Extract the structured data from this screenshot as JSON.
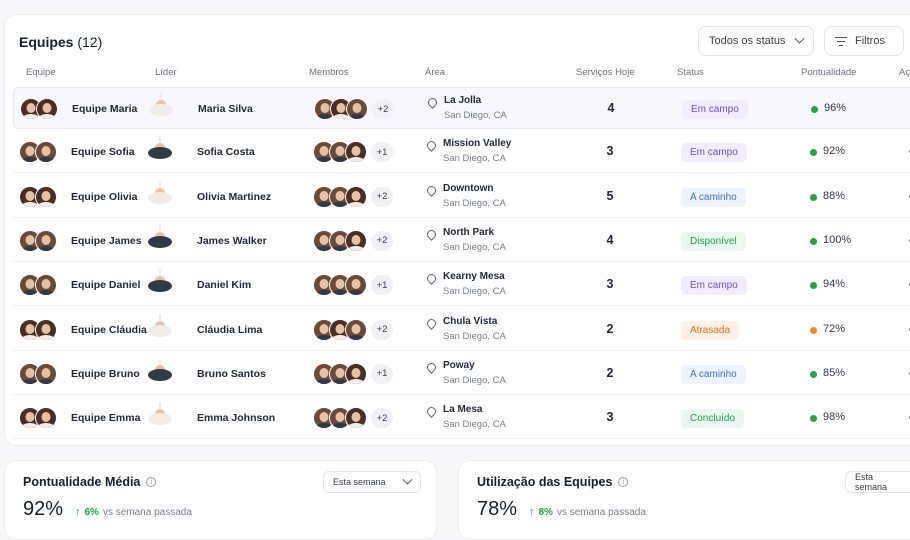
{
  "teams_card": {
    "title": "Equipes",
    "count": "(12)",
    "status_filter": "Todos os status",
    "filters_button": "Filtros",
    "columns": [
      "Equipe",
      "Líder",
      "Membros",
      "Área",
      "Serviços Hoje",
      "Status",
      "Pontualidade",
      "Ações"
    ]
  },
  "colors": {
    "accent": "#6d4ee0",
    "green_dot": "#22a447",
    "orange_dot": "#f08a24"
  },
  "rows": [
    {
      "team": "Equipe Maria",
      "leader": "Maria Silva",
      "leader_gender": "f",
      "team_avatars": [
        "f",
        "f"
      ],
      "members": [
        "m",
        "f",
        "m"
      ],
      "more": "+2",
      "area": "La Jolla",
      "city": "San Diego, CA",
      "services": "4",
      "status": "Em campo",
      "status_kind": "field",
      "punctuality": "96%",
      "dot": "green"
    },
    {
      "team": "Equipe Sofia",
      "leader": "Sofia Costa",
      "leader_gender": "m",
      "team_avatars": [
        "m",
        "m"
      ],
      "members": [
        "m",
        "m",
        "f"
      ],
      "more": "+1",
      "area": "Mission Valley",
      "city": "San Diego, CA",
      "services": "3",
      "status": "Em campo",
      "status_kind": "field",
      "punctuality": "92%",
      "dot": "green"
    },
    {
      "team": "Equipe Olivia",
      "leader": "Olivia Martinez",
      "leader_gender": "f",
      "team_avatars": [
        "f",
        "f"
      ],
      "members": [
        "m",
        "m",
        "f"
      ],
      "more": "+2",
      "area": "Downtown",
      "city": "San Diego, CA",
      "services": "5",
      "status": "A caminho",
      "status_kind": "route",
      "punctuality": "88%",
      "dot": "green"
    },
    {
      "team": "Equipe James",
      "leader": "James Walker",
      "leader_gender": "m",
      "team_avatars": [
        "m",
        "m"
      ],
      "members": [
        "m",
        "m",
        "f"
      ],
      "more": "+2",
      "area": "North Park",
      "city": "San Diego, CA",
      "services": "4",
      "status": "Disponível",
      "status_kind": "available",
      "punctuality": "100%",
      "dot": "green"
    },
    {
      "team": "Equipe Daniel",
      "leader": "Daniel Kim",
      "leader_gender": "m",
      "team_avatars": [
        "m",
        "m"
      ],
      "members": [
        "m",
        "m",
        "m"
      ],
      "more": "+1",
      "area": "Kearny Mesa",
      "city": "San Diego, CA",
      "services": "3",
      "status": "Em campo",
      "status_kind": "field",
      "punctuality": "94%",
      "dot": "green"
    },
    {
      "team": "Equipe Cláudia",
      "leader": "Cláudia Lima",
      "leader_gender": "f",
      "team_avatars": [
        "f",
        "f"
      ],
      "members": [
        "m",
        "f",
        "m"
      ],
      "more": "+2",
      "area": "Chula Vista",
      "city": "San Diego, CA",
      "services": "2",
      "status": "Atrasada",
      "status_kind": "late",
      "punctuality": "72%",
      "dot": "orange"
    },
    {
      "team": "Equipe Bruno",
      "leader": "Bruno Santos",
      "leader_gender": "m",
      "team_avatars": [
        "m",
        "m"
      ],
      "members": [
        "m",
        "m",
        "f"
      ],
      "more": "+1",
      "area": "Poway",
      "city": "San Diego, CA",
      "services": "2",
      "status": "A caminho",
      "status_kind": "route",
      "punctuality": "85%",
      "dot": "green"
    },
    {
      "team": "Equipe Emma",
      "leader": "Emma Johnson",
      "leader_gender": "f",
      "team_avatars": [
        "f",
        "f"
      ],
      "members": [
        "m",
        "m",
        "f"
      ],
      "more": "+2",
      "area": "La Mesa",
      "city": "San Diego, CA",
      "services": "3",
      "status": "Concluído",
      "status_kind": "done",
      "punctuality": "98%",
      "dot": "green"
    }
  ],
  "punctuality_card": {
    "title": "Pontualidade Média",
    "period": "Esta semana",
    "value": "92%",
    "delta": "6%",
    "delta_caption": "vs semana passada"
  },
  "utilization_card": {
    "title": "Utilização das Equipes",
    "period": "Esta semana",
    "value": "78%",
    "delta": "8%",
    "delta_caption": "vs semana passada"
  }
}
